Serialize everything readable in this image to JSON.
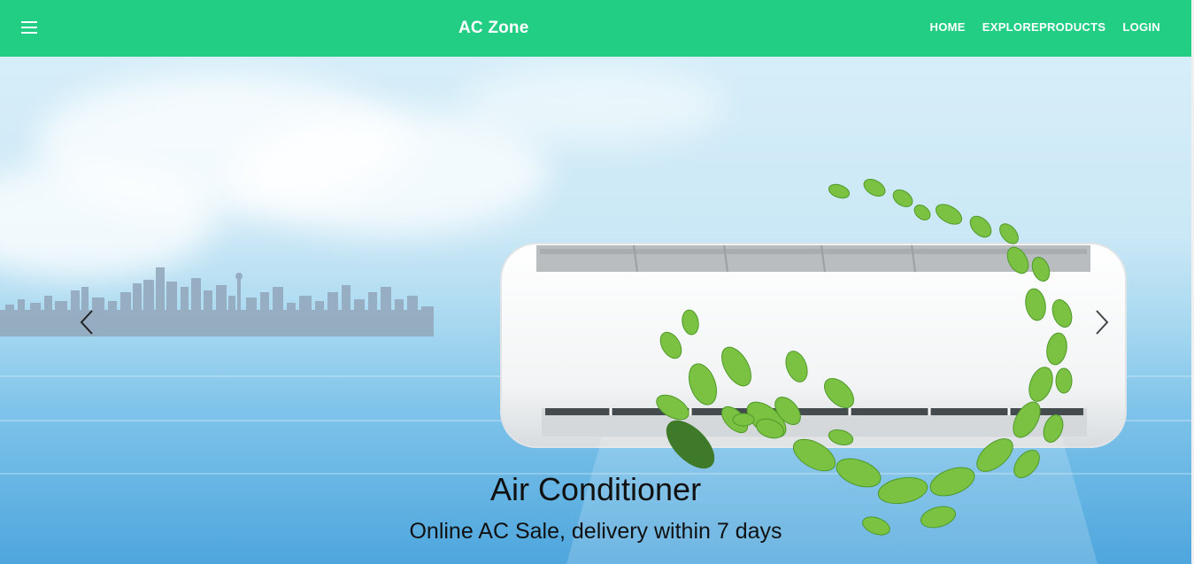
{
  "colors": {
    "navbar_bg": "#22cd84",
    "nav_text": "#ffffff"
  },
  "navbar": {
    "brand": "AC Zone",
    "menu_icon": "hamburger-icon",
    "links": [
      {
        "label": "HOME"
      },
      {
        "label": "EXPLOREPRODUCTS"
      },
      {
        "label": "LOGIN"
      }
    ]
  },
  "carousel": {
    "prev_icon": "chevron-left-icon",
    "next_icon": "chevron-right-icon",
    "slide": {
      "title": "Air Conditioner",
      "subtitle": "Online AC Sale, delivery within 7 days"
    }
  }
}
